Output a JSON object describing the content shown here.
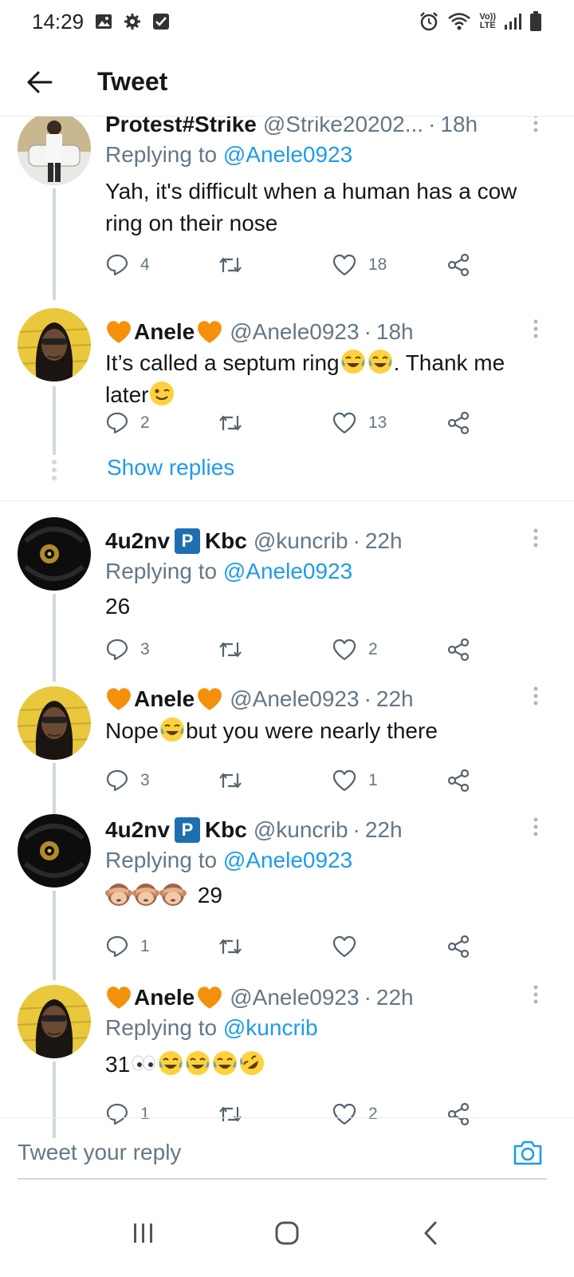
{
  "status_bar": {
    "time": "14:29",
    "left_icons": [
      "gallery-icon",
      "gear-icon",
      "check-box-icon"
    ],
    "right_icons": [
      "alarm-icon",
      "wifi-icon",
      "volte-icon",
      "signal-icon",
      "battery-icon"
    ],
    "volte_label_top": "Vo))",
    "volte_label_bottom": "LTE"
  },
  "header": {
    "title": "Tweet"
  },
  "tweets": [
    {
      "name": "Protest#Strike",
      "handle": "@Strike20202...",
      "time": "18h",
      "replying_prefix": "Replying to",
      "replying_to": "@Anele0923",
      "text": "Yah, it's difficult when a human has a cow ring on their nose",
      "replies": "4",
      "retweets": "",
      "likes": "18"
    },
    {
      "name": "Anele",
      "handle": "@Anele0923",
      "time": "18h",
      "text_part1": "It’s called a septum ring",
      "text_part2": ". Thank me later",
      "replies": "2",
      "retweets": "",
      "likes": "13",
      "show_replies": "Show replies"
    },
    {
      "name_part1": "4u2nv",
      "badge": "P",
      "name_part2": "Kbc",
      "handle": "@kuncrib",
      "time": "22h",
      "replying_prefix": "Replying to",
      "replying_to": "@Anele0923",
      "text": "26",
      "replies": "3",
      "retweets": "",
      "likes": "2"
    },
    {
      "name": "Anele",
      "handle": "@Anele0923",
      "time": "22h",
      "text_part1": "Nope",
      "text_part2": "but you were nearly there",
      "replies": "3",
      "retweets": "",
      "likes": "1"
    },
    {
      "name_part1": "4u2nv",
      "badge": "P",
      "name_part2": "Kbc",
      "handle": "@kuncrib",
      "time": "22h",
      "replying_prefix": "Replying to",
      "replying_to": "@Anele0923",
      "text": "29",
      "replies": "1",
      "retweets": "",
      "likes": ""
    },
    {
      "name": "Anele",
      "handle": "@Anele0923",
      "time": "22h",
      "replying_prefix": "Replying to",
      "replying_to": "@kuncrib",
      "text": "31",
      "replies": "1",
      "retweets": "",
      "likes": "2"
    }
  ],
  "composer": {
    "placeholder": "Tweet your reply"
  },
  "colors": {
    "link": "#1d9bf0",
    "secondary_text": "#657786",
    "badge": "#1f6fb0",
    "heart_emoji": "#f5900b"
  }
}
